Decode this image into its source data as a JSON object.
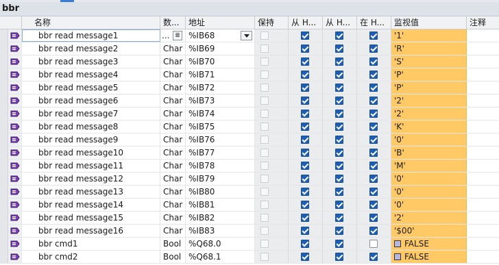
{
  "title": "bbr",
  "columns": {
    "name": "名称",
    "datatype": "数...",
    "address": "地址",
    "retain": "保持",
    "from_hmi": "从 H...",
    "visible_hmi": "从 H...",
    "in_hmi": "在 H...",
    "monitor": "监视值",
    "comment": "注释"
  },
  "rows": [
    {
      "name": "bbr read message1",
      "type": "...",
      "address": "%IB68",
      "retain": false,
      "h1": true,
      "h2": true,
      "h3": true,
      "monitor": "'1'",
      "selected": true
    },
    {
      "name": "bbr read message2",
      "type": "Char",
      "address": "%IB69",
      "retain": false,
      "h1": true,
      "h2": true,
      "h3": true,
      "monitor": "'R'"
    },
    {
      "name": "bbr read message3",
      "type": "Char",
      "address": "%IB70",
      "retain": false,
      "h1": true,
      "h2": true,
      "h3": true,
      "monitor": "'S'"
    },
    {
      "name": "bbr read message4",
      "type": "Char",
      "address": "%IB71",
      "retain": false,
      "h1": true,
      "h2": true,
      "h3": true,
      "monitor": "'P'"
    },
    {
      "name": "bbr read message5",
      "type": "Char",
      "address": "%IB72",
      "retain": false,
      "h1": true,
      "h2": true,
      "h3": true,
      "monitor": "'P'"
    },
    {
      "name": "bbr read message6",
      "type": "Char",
      "address": "%IB73",
      "retain": false,
      "h1": true,
      "h2": true,
      "h3": true,
      "monitor": "'2'"
    },
    {
      "name": "bbr read message7",
      "type": "Char",
      "address": "%IB74",
      "retain": false,
      "h1": true,
      "h2": true,
      "h3": true,
      "monitor": "'2'"
    },
    {
      "name": "bbr read message8",
      "type": "Char",
      "address": "%IB75",
      "retain": false,
      "h1": true,
      "h2": true,
      "h3": true,
      "monitor": "'K'"
    },
    {
      "name": "bbr read message9",
      "type": "Char",
      "address": "%IB76",
      "retain": false,
      "h1": true,
      "h2": true,
      "h3": true,
      "monitor": "'0'"
    },
    {
      "name": "bbr read message10",
      "type": "Char",
      "address": "%IB77",
      "retain": false,
      "h1": true,
      "h2": true,
      "h3": true,
      "monitor": "'B'"
    },
    {
      "name": "bbr read message11",
      "type": "Char",
      "address": "%IB78",
      "retain": false,
      "h1": true,
      "h2": true,
      "h3": true,
      "monitor": "'M'"
    },
    {
      "name": "bbr read message12",
      "type": "Char",
      "address": "%IB79",
      "retain": false,
      "h1": true,
      "h2": true,
      "h3": true,
      "monitor": "'0'"
    },
    {
      "name": "bbr read message13",
      "type": "Char",
      "address": "%IB80",
      "retain": false,
      "h1": true,
      "h2": true,
      "h3": true,
      "monitor": "'0'"
    },
    {
      "name": "bbr read message14",
      "type": "Char",
      "address": "%IB81",
      "retain": false,
      "h1": true,
      "h2": true,
      "h3": true,
      "monitor": "'0'"
    },
    {
      "name": "bbr read message15",
      "type": "Char",
      "address": "%IB82",
      "retain": false,
      "h1": true,
      "h2": true,
      "h3": true,
      "monitor": "'2'"
    },
    {
      "name": "bbr read message16",
      "type": "Char",
      "address": "%IB83",
      "retain": false,
      "h1": true,
      "h2": true,
      "h3": true,
      "monitor": "'$00'"
    },
    {
      "name": "bbr cmd1",
      "type": "Bool",
      "address": "%Q68.0",
      "retain": false,
      "h1": true,
      "h2": true,
      "h3": false,
      "monitor": "FALSE",
      "bool": true
    },
    {
      "name": "bbr cmd2",
      "type": "Bool",
      "address": "%Q68.1",
      "retain": false,
      "h1": true,
      "h2": true,
      "h3": true,
      "monitor": "FALSE",
      "bool": true
    }
  ],
  "colors": {
    "monitor_bg": "#ffc966",
    "checkbox_on": "#1e5fb4",
    "tag_icon": "#5a2d91"
  },
  "icons": {
    "tag": "plc-tag-icon",
    "type_picker": "datatype-picker-icon",
    "dropdown": "chevron-down-icon"
  }
}
